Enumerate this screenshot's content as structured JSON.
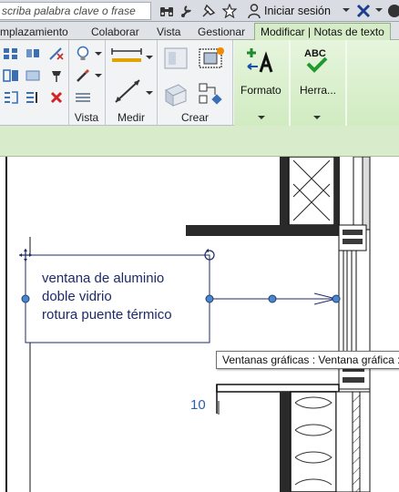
{
  "search": {
    "placeholder": "scriba palabra clave o frase"
  },
  "account": {
    "signin_label": "Iniciar sesión"
  },
  "ribbon_tabs": [
    {
      "label": "mplazamiento",
      "active": false
    },
    {
      "label": "Colaborar",
      "active": false
    },
    {
      "label": "Vista",
      "active": false
    },
    {
      "label": "Gestionar",
      "active": false
    },
    {
      "label": "Modificar | Notas de texto",
      "active": true
    }
  ],
  "ribbon_panels": {
    "vista": "Vista",
    "medir": "Medir",
    "crear": "Crear"
  },
  "context_buttons": {
    "formato": "Formato",
    "herramientas": "Herra..."
  },
  "herramientas_icon_text": "ABC",
  "text_note": {
    "lines": [
      "ventana de aluminio",
      "doble vidrio",
      "rotura puente térmico"
    ]
  },
  "tag_number": "10",
  "tooltip": {
    "text": "Ventanas gráficas : Ventana gráfica : T"
  },
  "colors": {
    "context_tab": "#d6ecc8",
    "options_bar": "#d8eccb",
    "note_text": "#1e2a66",
    "grip_blue": "#4a86c8",
    "tag_blue": "#2a5fb0"
  }
}
